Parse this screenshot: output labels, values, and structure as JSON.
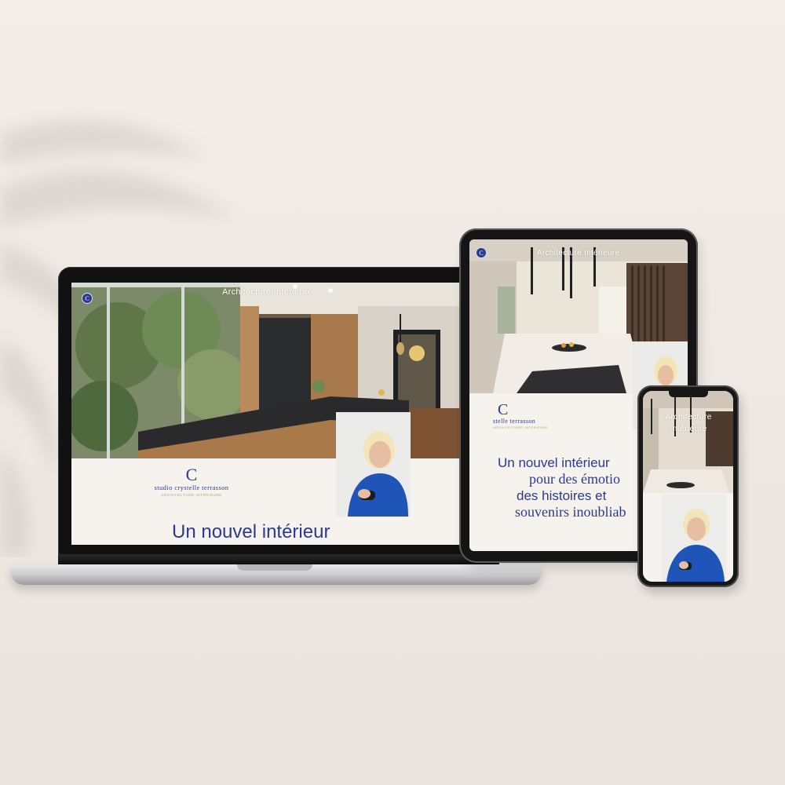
{
  "colors": {
    "brand_blue": "#2b3a8e",
    "brand_gold": "#b6a256",
    "page_cream": "#f6f3ee",
    "backdrop": "#f0e9e3"
  },
  "site": {
    "logo_letter": "C",
    "nav_title": "Architecture Intérieure",
    "nav_title_line1": "Architecture",
    "nav_title_line2": "Intérieure",
    "brand_name": "studio crystelle terrasson",
    "brand_name_partial": "stelle terrasson",
    "brand_tagline": "ARCHITECTURE INTÉRIEURE",
    "headline": "Un nouvel intérieur",
    "headline_lines": [
      "Un nouvel intérieur",
      "pour des émotio",
      "des histoires et",
      "souvenirs inoubliab"
    ],
    "menu_icon": "hamburger-menu-icon",
    "logo_icon": "logo-monogram-icon"
  },
  "devices": [
    "laptop",
    "tablet",
    "phone"
  ]
}
